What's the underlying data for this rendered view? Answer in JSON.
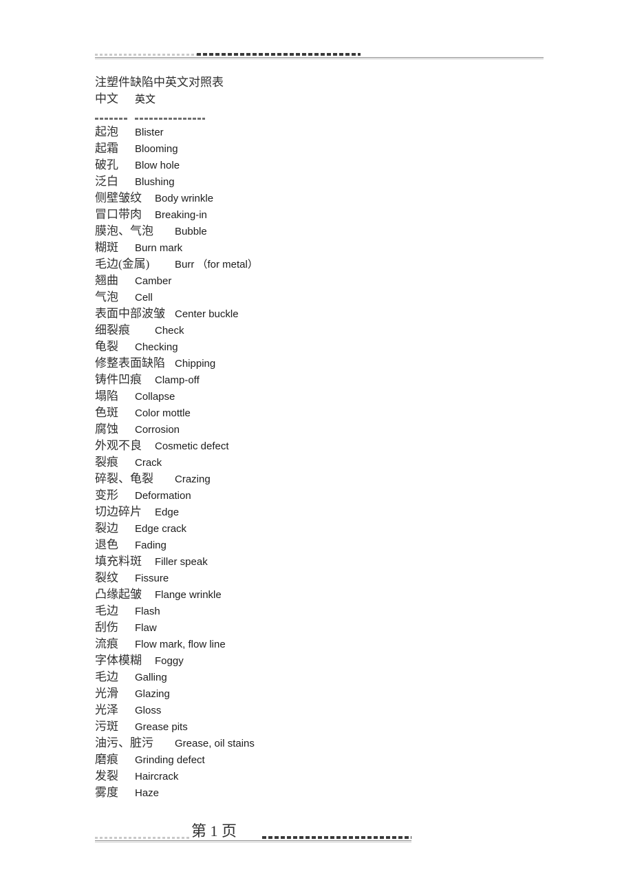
{
  "document": {
    "title": "注塑件缺陷中英文对照表",
    "column_headers": {
      "chinese": "中文",
      "english": "英文"
    },
    "separator": {
      "left_dashes": "--------",
      "right_dashes": "--------------------"
    }
  },
  "header_rule": {
    "style": "dashed-and-solid-rule"
  },
  "entries": [
    {
      "cn": "起泡",
      "en": "Blister"
    },
    {
      "cn": "起霜",
      "en": "Blooming"
    },
    {
      "cn": "破孔",
      "en": "Blow hole"
    },
    {
      "cn": "泛白",
      "en": "Blushing"
    },
    {
      "cn": "侧壁皱纹",
      "en": "Body wrinkle"
    },
    {
      "cn": "冒口带肉",
      "en": "Breaking-in"
    },
    {
      "cn": "膜泡、气泡",
      "en": "Bubble"
    },
    {
      "cn": "糊斑",
      "en": "Burn mark"
    },
    {
      "cn": "毛边(金属)",
      "en": "Burr （for metal）"
    },
    {
      "cn": "翘曲",
      "en": "Camber"
    },
    {
      "cn": "气泡",
      "en": "Cell"
    },
    {
      "cn": "表面中部波皱",
      "en": "Center buckle"
    },
    {
      "cn": "细裂痕",
      "en": "Check"
    },
    {
      "cn": "龟裂",
      "en": "Checking"
    },
    {
      "cn": "修整表面缺陷",
      "en": "Chipping"
    },
    {
      "cn": "铸件凹痕",
      "en": "Clamp-off"
    },
    {
      "cn": "塌陷",
      "en": "Collapse"
    },
    {
      "cn": "色斑",
      "en": "Color mottle"
    },
    {
      "cn": "腐蚀",
      "en": "Corrosion"
    },
    {
      "cn": "外观不良",
      "en": "Cosmetic defect"
    },
    {
      "cn": "裂痕",
      "en": "Crack"
    },
    {
      "cn": "碎裂、龟裂",
      "en": "Crazing"
    },
    {
      "cn": "变形",
      "en": "Deformation"
    },
    {
      "cn": "切边碎片",
      "en": "Edge"
    },
    {
      "cn": "裂边",
      "en": "Edge crack"
    },
    {
      "cn": "退色",
      "en": "Fading"
    },
    {
      "cn": "填充料斑",
      "en": "Filler speak"
    },
    {
      "cn": "裂纹",
      "en": "Fissure"
    },
    {
      "cn": "凸缘起皱",
      "en": "Flange wrinkle"
    },
    {
      "cn": "毛边",
      "en": "Flash"
    },
    {
      "cn": "刮伤",
      "en": "Flaw"
    },
    {
      "cn": "流痕",
      "en": "Flow mark, flow line"
    },
    {
      "cn": "字体模糊",
      "en": "Foggy"
    },
    {
      "cn": "毛边",
      "en": "Galling"
    },
    {
      "cn": "光滑",
      "en": "Glazing"
    },
    {
      "cn": "光泽",
      "en": "Gloss"
    },
    {
      "cn": "污斑",
      "en": "Grease pits"
    },
    {
      "cn": "油污、脏污",
      "en": "Grease, oil stains"
    },
    {
      "cn": "磨痕",
      "en": "Grinding defect"
    },
    {
      "cn": "发裂",
      "en": "Haircrack"
    },
    {
      "cn": "雾度",
      "en": "Haze"
    }
  ],
  "footer": {
    "page_label": "第 1 页"
  },
  "colors": {
    "page_background": "#ffffff",
    "body_text": "#2b2b2b",
    "chinese_text": "#303030",
    "english_text": "#1c1c1c",
    "rule_dark": "#3a3a3a",
    "rule_light": "#c9c9c9",
    "rule_thin": "#8f8f8f"
  }
}
